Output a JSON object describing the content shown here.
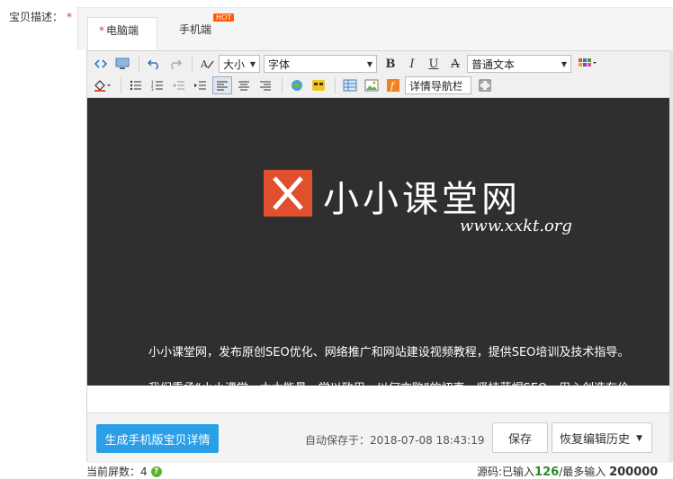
{
  "field": {
    "label": "宝贝描述：",
    "required_mark": "*"
  },
  "tabs": {
    "desktop": {
      "star": "*",
      "label": "电脑端"
    },
    "mobile": {
      "label": "手机端",
      "badge": "HOT"
    }
  },
  "toolbar": {
    "size_select": "大小",
    "font_select": "字体",
    "style_select": "普通文本",
    "detail_nav_select": "详情导航栏",
    "icons_row1": [
      "source-code-icon",
      "preview-icon",
      "undo-icon",
      "redo-icon",
      "clear-format-icon",
      "bold-icon",
      "italic-icon",
      "underline-icon",
      "strikethrough-icon",
      "table-grid-icon"
    ],
    "icons_row2": [
      "fill-color-icon",
      "unordered-list-icon",
      "ordered-list-icon",
      "outdent-icon",
      "indent-icon",
      "align-left-icon",
      "align-center-icon",
      "align-right-icon",
      "link-icon",
      "emoji-icon",
      "table-icon",
      "image-icon",
      "flash-icon",
      "fullscreen-icon"
    ]
  },
  "content": {
    "brand_name": "小小课堂网",
    "brand_url": "www.xxkt.org",
    "paragraph1": "小小课堂网，发布原创SEO优化、网络推广和网站建设视频教程，提供SEO培训及技术指导。",
    "paragraph2": "我们秉承“小小课堂，大大能量，学以致用，以何言败”的初衷，坚持蓝帽SEO，用心创造有价",
    "colors": {
      "background": "#2f2f2f",
      "logo": "#e0502f"
    }
  },
  "footer": {
    "generate_mobile_button": "生成手机版宝贝详情",
    "autosave_prefix": "自动保存于：",
    "autosave_time": "2018-07-08 18:43:19",
    "save_button": "保存",
    "restore_history_button": "恢复编辑历史"
  },
  "status": {
    "screen_count_label": "当前屏数：",
    "screen_count": "4",
    "source_prefix": "源码:已输入",
    "source_entered": "126",
    "max_prefix": "/最多输入",
    "max_value": "200000"
  },
  "accent_color": "#2a9fe8"
}
